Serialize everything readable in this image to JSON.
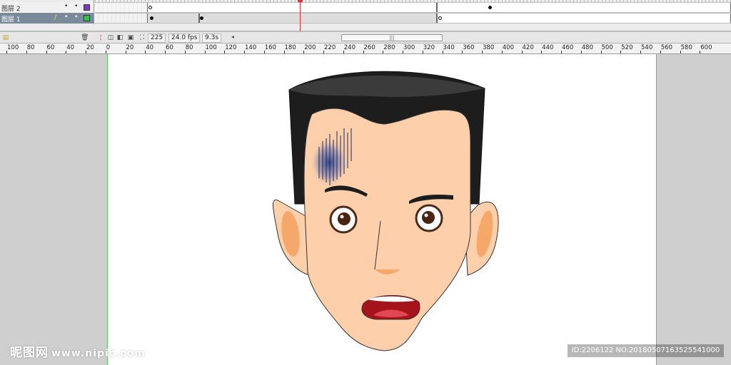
{
  "timeline": {
    "layers": [
      {
        "name": "图层 2",
        "color": "#7a3bc4",
        "selected": false
      },
      {
        "name": "图层 1",
        "color": "#38c04a",
        "selected": true
      }
    ],
    "current_frame": "225",
    "frame_rate": "24.0 fps",
    "elapsed_time": "9.3s"
  },
  "ruler": {
    "labels": [
      "100",
      "80",
      "60",
      "40",
      "20",
      "0",
      "20",
      "40",
      "60",
      "80",
      "100",
      "120",
      "140",
      "160",
      "180",
      "200",
      "220",
      "240",
      "260",
      "280",
      "300",
      "320",
      "340",
      "360",
      "380",
      "400",
      "420",
      "440",
      "460",
      "480",
      "500",
      "520",
      "540",
      "560",
      "580",
      "600"
    ]
  },
  "stage": {
    "skin_color": "#fdcfaa",
    "hair_color": "#1d1d1d",
    "mouth_color": "#a5141b",
    "bruise_color": "#1f3a86"
  },
  "watermark": {
    "brand": "昵图网",
    "url": "www.nipic.com",
    "id_text": "ID:2206122 NO:20180507163525541000"
  },
  "icons": {
    "add_layer": "add-layer-icon",
    "delete_layer": "trash-icon",
    "onion_skin": "onion-skin-icon",
    "center_frame": "center-frame-icon"
  }
}
